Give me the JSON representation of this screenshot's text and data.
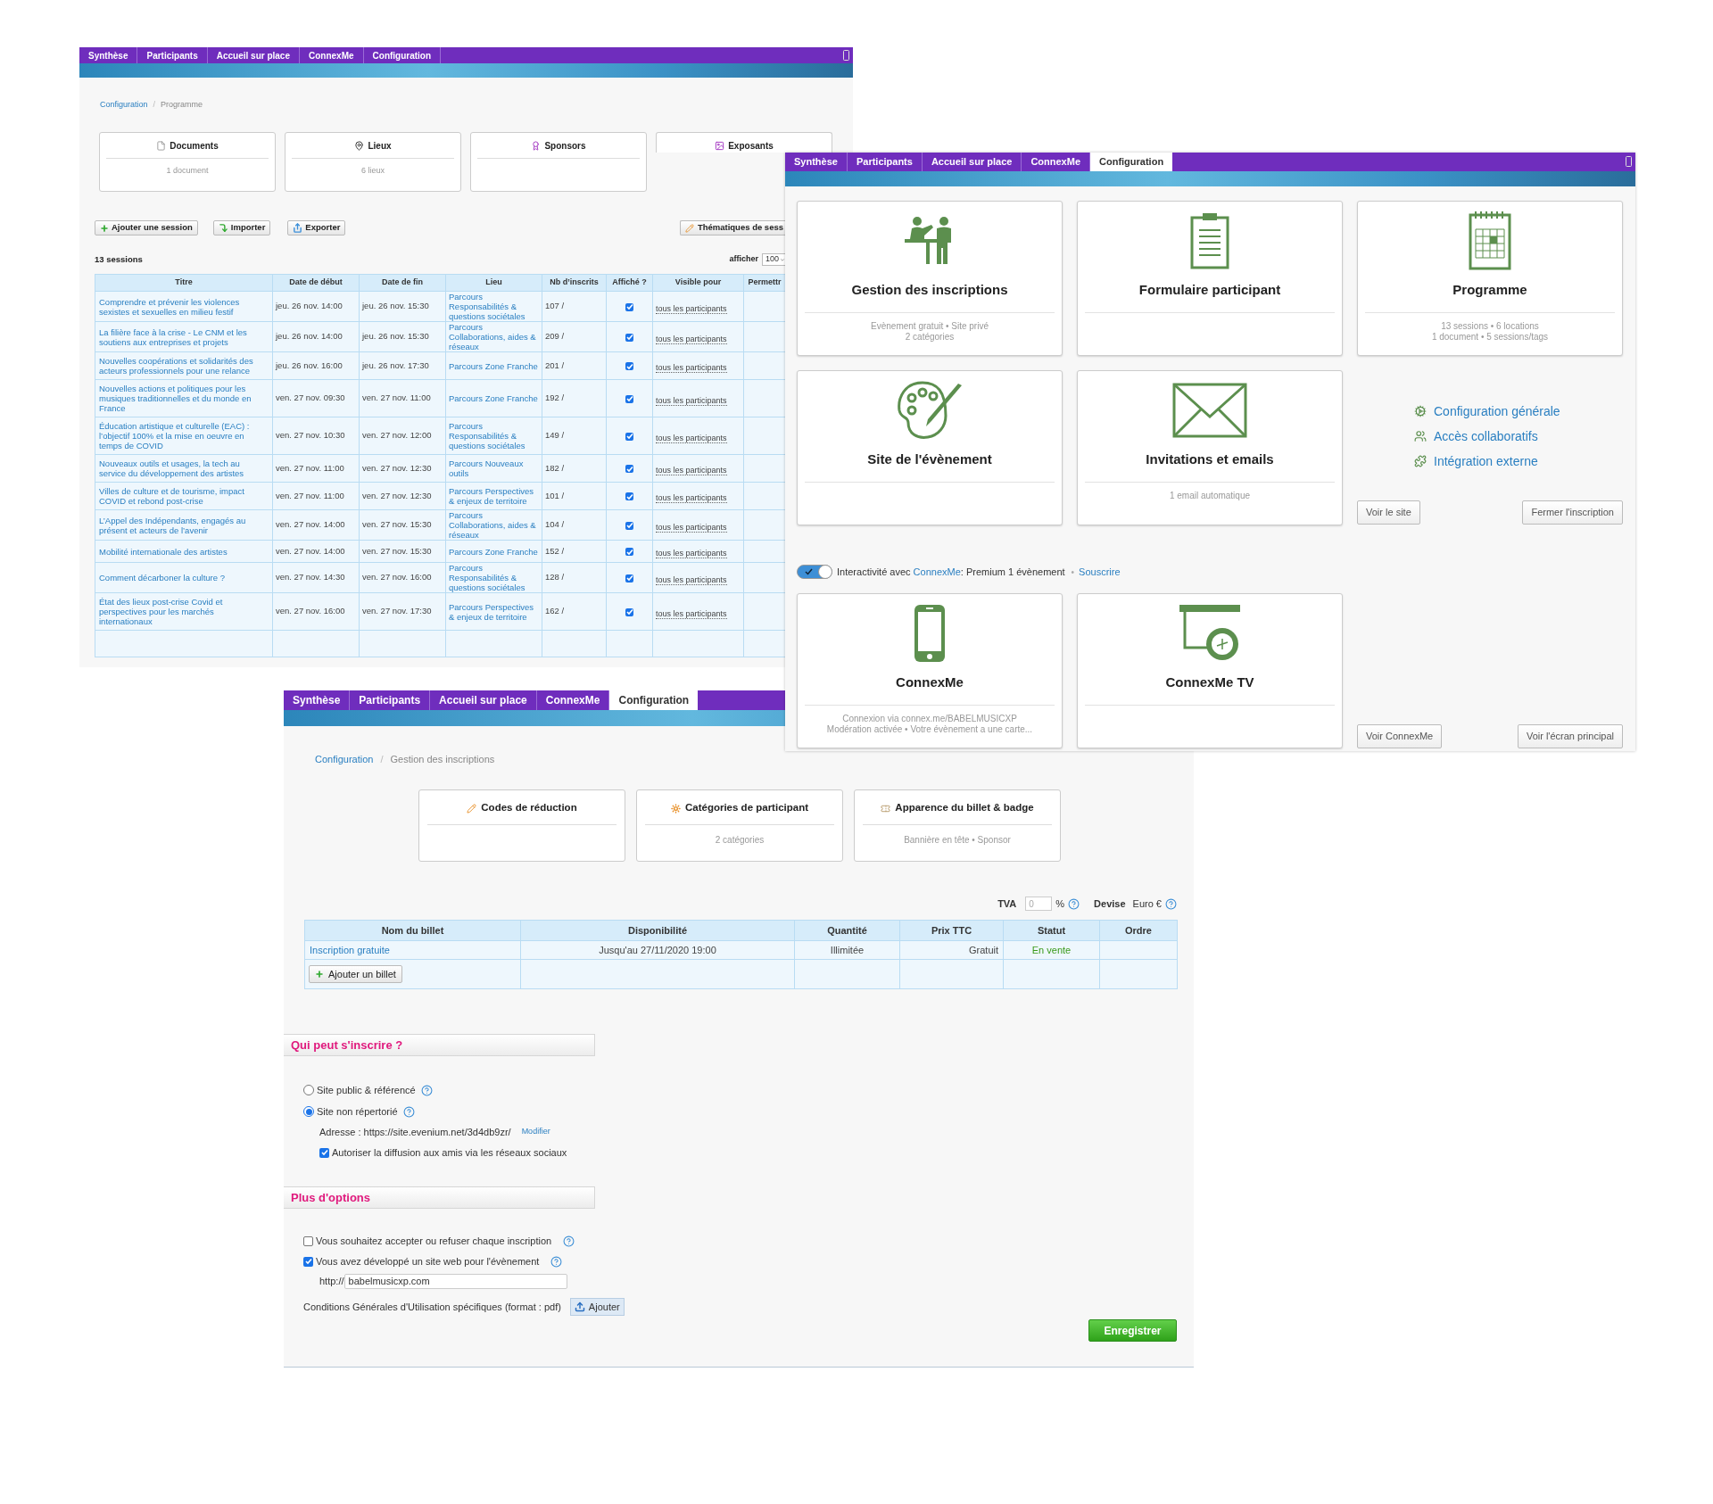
{
  "programme_window": {
    "nav_tabs": [
      {
        "label": "Synthèse",
        "selected": false
      },
      {
        "label": "Participants",
        "selected": false
      },
      {
        "label": "Accueil sur place",
        "selected": false
      },
      {
        "label": "ConnexMe",
        "selected": false
      },
      {
        "label": "Configuration",
        "selected": false
      }
    ],
    "breadcrumb": [
      "Configuration",
      "Programme"
    ],
    "breadcrumb_separator": "/",
    "cards": [
      {
        "title": "Documents",
        "subtitle": "1 document"
      },
      {
        "title": "Lieux",
        "subtitle": "6 lieux"
      },
      {
        "title": "Sponsors"
      },
      {
        "title": "Exposants"
      }
    ],
    "actions": [
      "Ajouter une session",
      "Importer",
      "Exporter"
    ],
    "themes_button": "Thématiques de sess",
    "session_count": "13 sessions",
    "show_label": "afficher",
    "show_value": "100",
    "table": {
      "columns": [
        "Titre",
        "Date de début",
        "Date de fin",
        "Lieu",
        "Nb d’inscrits",
        "Affiché ?",
        "Visible pour",
        "Permettr"
      ],
      "rows": [
        {
          "title": "Comprendre et prévenir les violences sexistes et sexuelles en milieu festif",
          "start": "jeu. 26 nov. 14:00",
          "end": "jeu. 26 nov. 15:30",
          "place": "Parcours Responsabilités & questions sociétales",
          "registered": "107 /",
          "displayed": true,
          "visible_for": "tous les participants"
        },
        {
          "title": "La filière face à la crise - Le CNM et les soutiens aux entreprises et projets",
          "start": "jeu. 26 nov. 14:00",
          "end": "jeu. 26 nov. 15:30",
          "place": "Parcours Collaborations, aides & réseaux",
          "registered": "209 /",
          "displayed": true,
          "visible_for": "tous les participants"
        },
        {
          "title": "Nouvelles coopérations et solidarités des acteurs professionnels pour une relance",
          "start": "jeu. 26 nov. 16:00",
          "end": "jeu. 26 nov. 17:30",
          "place": "Parcours Zone Franche",
          "registered": "201 /",
          "displayed": true,
          "visible_for": "tous les participants"
        },
        {
          "title": "Nouvelles actions et politiques pour les musiques traditionnelles et du monde en France",
          "start": "ven. 27 nov. 09:30",
          "end": "ven. 27 nov. 11:00",
          "place": "Parcours Zone Franche",
          "registered": "192 /",
          "displayed": true,
          "visible_for": "tous les participants"
        },
        {
          "title": "Éducation artistique et culturelle (EAC) : l’objectif 100% et la mise en oeuvre en temps de COVID",
          "start": "ven. 27 nov. 10:30",
          "end": "ven. 27 nov. 12:00",
          "place": "Parcours Responsabilités & questions sociétales",
          "registered": "149 /",
          "displayed": true,
          "visible_for": "tous les participants"
        },
        {
          "title": "Nouveaux outils et usages, la tech au service du développement des artistes",
          "start": "ven. 27 nov. 11:00",
          "end": "ven. 27 nov. 12:30",
          "place": "Parcours Nouveaux outils",
          "registered": "182 /",
          "displayed": true,
          "visible_for": "tous les participants"
        },
        {
          "title": "Villes de culture et de tourisme, impact COVID et rebond post-crise",
          "start": "ven. 27 nov. 11:00",
          "end": "ven. 27 nov. 12:30",
          "place": "Parcours Perspectives & enjeux de territoire",
          "registered": "101 /",
          "displayed": true,
          "visible_for": "tous les participants"
        },
        {
          "title": "L’Appel des Indépendants, engagés au présent et acteurs de l’avenir",
          "start": "ven. 27 nov. 14:00",
          "end": "ven. 27 nov. 15:30",
          "place": "Parcours Collaborations, aides & réseaux",
          "registered": "104 /",
          "displayed": true,
          "visible_for": "tous les participants"
        },
        {
          "title": "Mobilité internationale des artistes",
          "start": "ven. 27 nov. 14:00",
          "end": "ven. 27 nov. 15:30",
          "place": "Parcours Zone Franche",
          "registered": "152 /",
          "displayed": true,
          "visible_for": "tous les participants"
        },
        {
          "title": "Comment décarboner la culture ?",
          "start": "ven. 27 nov. 14:30",
          "end": "ven. 27 nov. 16:00",
          "place": "Parcours Responsabilités & questions sociétales",
          "registered": "128 /",
          "displayed": true,
          "visible_for": "tous les participants"
        },
        {
          "title": "État des lieux post-crise Covid et perspectives pour les marchés internationaux",
          "start": "ven. 27 nov. 16:00",
          "end": "ven. 27 nov. 17:30",
          "place": "Parcours Perspectives & enjeux de territoire",
          "registered": "162 /",
          "displayed": true,
          "visible_for": "tous les participants"
        }
      ]
    }
  },
  "inscriptions_window": {
    "nav_tabs": [
      {
        "label": "Synthèse",
        "selected": false
      },
      {
        "label": "Participants",
        "selected": false
      },
      {
        "label": "Accueil sur place",
        "selected": false
      },
      {
        "label": "ConnexMe",
        "selected": false
      },
      {
        "label": "Configuration",
        "selected": true
      }
    ],
    "breadcrumb": [
      "Configuration",
      "Gestion des inscriptions"
    ],
    "breadcrumb_separator": "/",
    "cards": [
      {
        "title": "Codes de réduction"
      },
      {
        "title": "Catégories de participant",
        "subtitle": "2 catégories"
      },
      {
        "title": "Apparence du billet & badge",
        "subtitle": "Bannière en tête • Sponsor"
      }
    ],
    "tva_label": "TVA",
    "tva_value": "0",
    "percent": "%",
    "currency_label": "Devise",
    "currency_value": "Euro €",
    "tickets": {
      "columns": [
        "Nom du billet",
        "Disponibilité",
        "Quantité",
        "Prix TTC",
        "Statut",
        "Ordre"
      ],
      "rows": [
        {
          "name": "Inscription gratuite",
          "availability": "Jusqu'au 27/11/2020 19:00",
          "quantity": "Illimitée",
          "price": "Gratuit",
          "status": "En vente"
        }
      ],
      "add_button": "Ajouter un billet"
    },
    "who_section": {
      "title": "Qui peut s'inscrire ?",
      "radios": [
        {
          "label": "Site public & référencé",
          "selected": false
        },
        {
          "label": "Site non répertorié",
          "selected": true
        }
      ],
      "address": "Adresse : https://site.evenium.net/3d4db9zr/",
      "modify_link": "Modifier",
      "share_option": {
        "label": "Autoriser la diffusion aux amis via les réseaux sociaux",
        "checked": true
      }
    },
    "options_section": {
      "title": "Plus d'options",
      "options": [
        {
          "label": "Vous souhaitez accepter ou refuser chaque inscription",
          "checked": false
        },
        {
          "label": "Vous avez développé un site web pour l'évènement",
          "checked": true
        }
      ],
      "url_prefix": "http://",
      "url_value": "babelmusicxp.com",
      "terms_label": "Conditions Générales d'Utilisation spécifiques (format : pdf)",
      "upload_button": "Ajouter"
    },
    "save_button": "Enregistrer"
  },
  "configuration_window": {
    "nav_tabs": [
      {
        "label": "Synthèse",
        "selected": false
      },
      {
        "label": "Participants",
        "selected": false
      },
      {
        "label": "Accueil sur place",
        "selected": false
      },
      {
        "label": "ConnexMe",
        "selected": false
      },
      {
        "label": "Configuration",
        "selected": true
      }
    ],
    "cards": [
      {
        "title": "Gestion des inscriptions",
        "lines": [
          "Evènement gratuit • Site privé",
          "2 catégories"
        ]
      },
      {
        "title": "Formulaire participant"
      },
      {
        "title": "Programme",
        "lines": [
          "13 sessions • 6 locations",
          "1 document • 5 sessions/tags"
        ]
      },
      {
        "title": "Site de l'évènement"
      },
      {
        "title": "Invitations et emails",
        "lines": [
          "1 email automatique"
        ]
      }
    ],
    "links": [
      "Configuration générale",
      "Accès collaboratifs",
      "Intégration externe"
    ],
    "site_buttons": [
      "Voir le site",
      "Fermer l'inscription"
    ],
    "interactivity": {
      "on": true,
      "prefix": "Interactivité avec",
      "link": "ConnexMe",
      "suffix": ": Premium 1 évènement",
      "separator": "•",
      "subscribe": "Souscrire"
    },
    "connexme_cards": [
      {
        "title": "ConnexMe",
        "lines": [
          "Connexion via connex.me/BABELMUSICXP",
          "Modération activée • Votre évènement a une carte..."
        ]
      },
      {
        "title": "ConnexMe TV"
      }
    ],
    "connexme_buttons": [
      "Voir ConnexMe",
      "Voir l'écran principal"
    ]
  }
}
